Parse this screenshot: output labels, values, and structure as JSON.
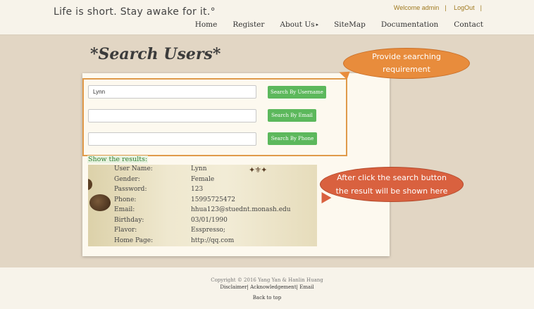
{
  "header": {
    "tagline": "Life is short. Stay awake for it.°",
    "welcome": "Welcome admin",
    "separator": "|",
    "logout": "LogOut",
    "nav": [
      "Home",
      "Register",
      "About Us",
      "SiteMap",
      "Documentation",
      "Contact"
    ],
    "about_caret": "▸"
  },
  "page": {
    "title": "*Search Users*"
  },
  "search": {
    "username_value": "Lynn",
    "email_value": "",
    "phone_value": "",
    "btn_username": "Search By Username",
    "btn_email": "Search By Email",
    "btn_phone": "Search By Phone"
  },
  "results": {
    "label": "Show the results:",
    "ornament": "✦⚜✦",
    "rows": [
      {
        "key": "User Name:",
        "value": "Lynn"
      },
      {
        "key": "Gender:",
        "value": "Female"
      },
      {
        "key": "Password:",
        "value": "123"
      },
      {
        "key": "Phone:",
        "value": "15995725472"
      },
      {
        "key": "Email:",
        "value": "hhua123@stuednt.monash.edu"
      },
      {
        "key": "Birthday:",
        "value": "03/01/1990"
      },
      {
        "key": "Flavor:",
        "value": "Esspresso;"
      },
      {
        "key": "Home Page:",
        "value": "http://qq.com"
      }
    ]
  },
  "callouts": {
    "first_line1": "Provide searching",
    "first_line2": "requirement",
    "second_line1": "After click the search button",
    "second_line2": "the result will be shown here"
  },
  "footer": {
    "copyright": "Copyright © 2016 Yang Yan & Hanlin Huang",
    "disclaimer": "Disclaimer",
    "acknowledgement": "Acknowledgement",
    "email": "Email",
    "sep": "|",
    "back_to_top": "Back to top"
  },
  "colors": {
    "accent_green": "#5cb85c",
    "callout_orange": "#e88c3c",
    "callout_red": "#d9613f",
    "border_orange": "#e09a4a"
  }
}
